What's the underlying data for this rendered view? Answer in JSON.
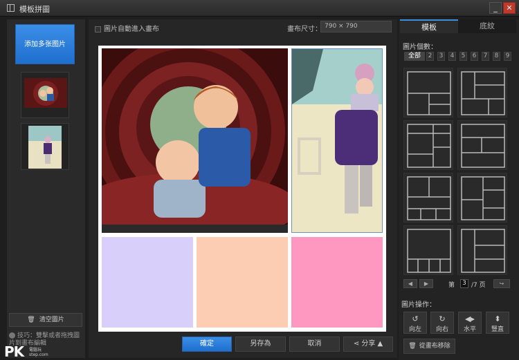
{
  "window": {
    "title": "模板拼圖",
    "minimize": "_",
    "close": "✕"
  },
  "left_panel": {
    "add_button": "添加多张图片",
    "clear_button": "清空圖片",
    "tip": "技巧：雙擊或者拖拽圖片到畫布編輯"
  },
  "center": {
    "auto_option": "圖片自動進入畫布",
    "canvas_size_label": "畫布尺寸：",
    "canvas_size_value": "790  ×  790",
    "cell_colors": [
      "#d8d0fb",
      "#fdcdb3",
      "#fe98c0"
    ],
    "buttons": {
      "ok": "確定",
      "save_as": "另存為",
      "cancel": "取消",
      "share": "分享"
    }
  },
  "right_panel": {
    "tabs": [
      "模板",
      "底紋"
    ],
    "count_label": "圖片個數：",
    "counts": [
      "全部",
      "2",
      "3",
      "4",
      "5",
      "6",
      "7",
      "8",
      "9"
    ],
    "page_label_pre": "第",
    "page_current": "3",
    "page_label_post": "/7 页",
    "ops_label": "圖片操作：",
    "ops": [
      "向左",
      "向右",
      "水平",
      "豎直"
    ],
    "remove_button": "從畫布移除"
  },
  "watermark": {
    "logo": "PK",
    "sub1": "電腦玩",
    "sub2": "step.com"
  },
  "colors": {
    "accent": "#3b8ee6",
    "photo_border": "#6c90c6"
  }
}
